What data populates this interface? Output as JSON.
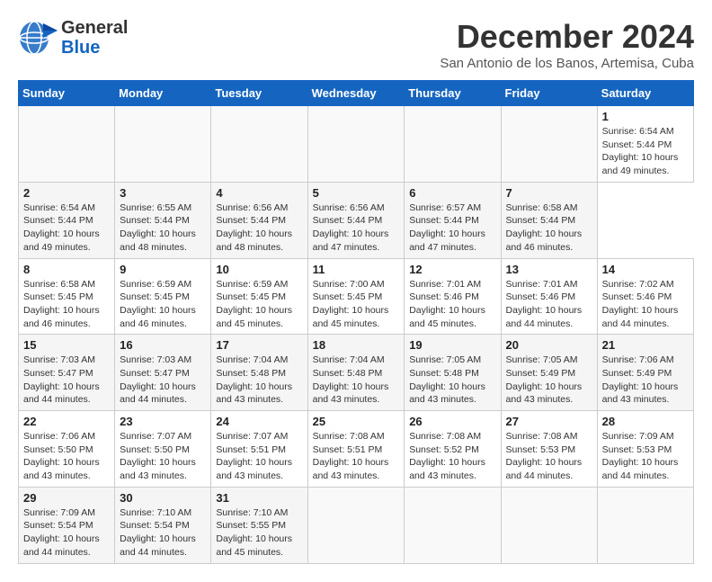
{
  "header": {
    "logo_line1": "General",
    "logo_line2": "Blue",
    "title": "December 2024",
    "subtitle": "San Antonio de los Banos, Artemisa, Cuba"
  },
  "calendar": {
    "columns": [
      "Sunday",
      "Monday",
      "Tuesday",
      "Wednesday",
      "Thursday",
      "Friday",
      "Saturday"
    ],
    "weeks": [
      [
        {
          "day": "",
          "info": ""
        },
        {
          "day": "",
          "info": ""
        },
        {
          "day": "",
          "info": ""
        },
        {
          "day": "",
          "info": ""
        },
        {
          "day": "",
          "info": ""
        },
        {
          "day": "",
          "info": ""
        },
        {
          "day": "1",
          "info": "Sunrise: 6:54 AM\nSunset: 5:44 PM\nDaylight: 10 hours\nand 49 minutes."
        }
      ],
      [
        {
          "day": "2",
          "info": "Sunrise: 6:54 AM\nSunset: 5:44 PM\nDaylight: 10 hours\nand 49 minutes."
        },
        {
          "day": "3",
          "info": "Sunrise: 6:55 AM\nSunset: 5:44 PM\nDaylight: 10 hours\nand 48 minutes."
        },
        {
          "day": "4",
          "info": "Sunrise: 6:56 AM\nSunset: 5:44 PM\nDaylight: 10 hours\nand 48 minutes."
        },
        {
          "day": "5",
          "info": "Sunrise: 6:56 AM\nSunset: 5:44 PM\nDaylight: 10 hours\nand 47 minutes."
        },
        {
          "day": "6",
          "info": "Sunrise: 6:57 AM\nSunset: 5:44 PM\nDaylight: 10 hours\nand 47 minutes."
        },
        {
          "day": "7",
          "info": "Sunrise: 6:58 AM\nSunset: 5:44 PM\nDaylight: 10 hours\nand 46 minutes."
        }
      ],
      [
        {
          "day": "8",
          "info": "Sunrise: 6:58 AM\nSunset: 5:45 PM\nDaylight: 10 hours\nand 46 minutes."
        },
        {
          "day": "9",
          "info": "Sunrise: 6:59 AM\nSunset: 5:45 PM\nDaylight: 10 hours\nand 46 minutes."
        },
        {
          "day": "10",
          "info": "Sunrise: 6:59 AM\nSunset: 5:45 PM\nDaylight: 10 hours\nand 45 minutes."
        },
        {
          "day": "11",
          "info": "Sunrise: 7:00 AM\nSunset: 5:45 PM\nDaylight: 10 hours\nand 45 minutes."
        },
        {
          "day": "12",
          "info": "Sunrise: 7:01 AM\nSunset: 5:46 PM\nDaylight: 10 hours\nand 45 minutes."
        },
        {
          "day": "13",
          "info": "Sunrise: 7:01 AM\nSunset: 5:46 PM\nDaylight: 10 hours\nand 44 minutes."
        },
        {
          "day": "14",
          "info": "Sunrise: 7:02 AM\nSunset: 5:46 PM\nDaylight: 10 hours\nand 44 minutes."
        }
      ],
      [
        {
          "day": "15",
          "info": "Sunrise: 7:03 AM\nSunset: 5:47 PM\nDaylight: 10 hours\nand 44 minutes."
        },
        {
          "day": "16",
          "info": "Sunrise: 7:03 AM\nSunset: 5:47 PM\nDaylight: 10 hours\nand 44 minutes."
        },
        {
          "day": "17",
          "info": "Sunrise: 7:04 AM\nSunset: 5:48 PM\nDaylight: 10 hours\nand 43 minutes."
        },
        {
          "day": "18",
          "info": "Sunrise: 7:04 AM\nSunset: 5:48 PM\nDaylight: 10 hours\nand 43 minutes."
        },
        {
          "day": "19",
          "info": "Sunrise: 7:05 AM\nSunset: 5:48 PM\nDaylight: 10 hours\nand 43 minutes."
        },
        {
          "day": "20",
          "info": "Sunrise: 7:05 AM\nSunset: 5:49 PM\nDaylight: 10 hours\nand 43 minutes."
        },
        {
          "day": "21",
          "info": "Sunrise: 7:06 AM\nSunset: 5:49 PM\nDaylight: 10 hours\nand 43 minutes."
        }
      ],
      [
        {
          "day": "22",
          "info": "Sunrise: 7:06 AM\nSunset: 5:50 PM\nDaylight: 10 hours\nand 43 minutes."
        },
        {
          "day": "23",
          "info": "Sunrise: 7:07 AM\nSunset: 5:50 PM\nDaylight: 10 hours\nand 43 minutes."
        },
        {
          "day": "24",
          "info": "Sunrise: 7:07 AM\nSunset: 5:51 PM\nDaylight: 10 hours\nand 43 minutes."
        },
        {
          "day": "25",
          "info": "Sunrise: 7:08 AM\nSunset: 5:51 PM\nDaylight: 10 hours\nand 43 minutes."
        },
        {
          "day": "26",
          "info": "Sunrise: 7:08 AM\nSunset: 5:52 PM\nDaylight: 10 hours\nand 43 minutes."
        },
        {
          "day": "27",
          "info": "Sunrise: 7:08 AM\nSunset: 5:53 PM\nDaylight: 10 hours\nand 44 minutes."
        },
        {
          "day": "28",
          "info": "Sunrise: 7:09 AM\nSunset: 5:53 PM\nDaylight: 10 hours\nand 44 minutes."
        }
      ],
      [
        {
          "day": "29",
          "info": "Sunrise: 7:09 AM\nSunset: 5:54 PM\nDaylight: 10 hours\nand 44 minutes."
        },
        {
          "day": "30",
          "info": "Sunrise: 7:10 AM\nSunset: 5:54 PM\nDaylight: 10 hours\nand 44 minutes."
        },
        {
          "day": "31",
          "info": "Sunrise: 7:10 AM\nSunset: 5:55 PM\nDaylight: 10 hours\nand 45 minutes."
        },
        {
          "day": "",
          "info": ""
        },
        {
          "day": "",
          "info": ""
        },
        {
          "day": "",
          "info": ""
        },
        {
          "day": "",
          "info": ""
        }
      ]
    ]
  }
}
